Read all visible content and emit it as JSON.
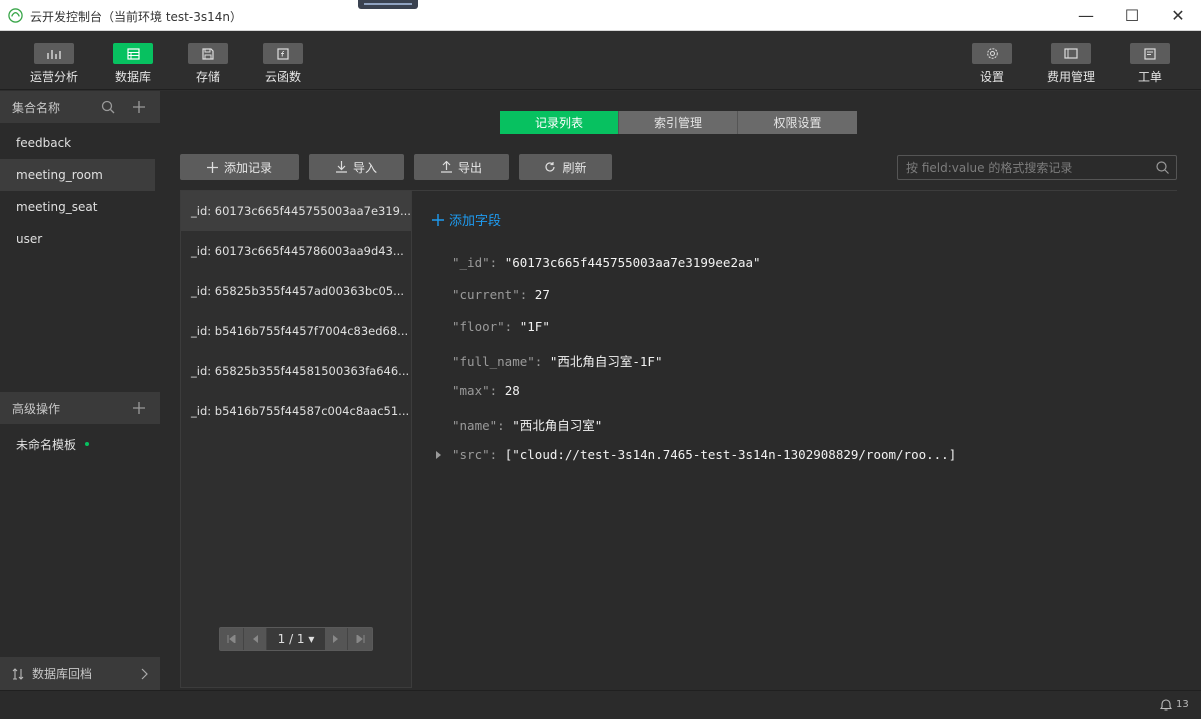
{
  "window": {
    "title": "云开发控制台（当前环境 test-3s14n）",
    "controls": {
      "minimize": "—",
      "maximize": "☐",
      "close": "✕"
    }
  },
  "toolbar": {
    "left": [
      {
        "label": "运营分析",
        "icon": "chart-icon"
      },
      {
        "label": "数据库",
        "icon": "database-icon",
        "active": true
      },
      {
        "label": "存储",
        "icon": "storage-icon"
      },
      {
        "label": "云函数",
        "icon": "function-icon"
      }
    ],
    "right": [
      {
        "label": "设置",
        "icon": "gear-icon"
      },
      {
        "label": "费用管理",
        "icon": "billing-icon"
      },
      {
        "label": "工单",
        "icon": "ticket-icon"
      }
    ]
  },
  "sidebar": {
    "collections_header": "集合名称",
    "collections": [
      "feedback",
      "meeting_room",
      "meeting_seat",
      "user"
    ],
    "selected_collection": "meeting_room",
    "advanced_header": "高级操作",
    "templates": [
      "未命名模板"
    ],
    "footer": "数据库回档"
  },
  "tabs": [
    "记录列表",
    "索引管理",
    "权限设置"
  ],
  "active_tab": "记录列表",
  "actions": {
    "add": "添加记录",
    "import": "导入",
    "export": "导出",
    "refresh": "刷新"
  },
  "search": {
    "placeholder": "按 field:value 的格式搜索记录"
  },
  "records": [
    "_id: 60173c665f445755003aa7e319...",
    "_id: 60173c665f445786003aa9d43...",
    "_id: 65825b355f4457ad00363bc05...",
    "_id: b5416b755f4457f7004c83ed68...",
    "_id: 65825b355f44581500363fa646...",
    "_id: b5416b755f44587c004c8aac51..."
  ],
  "pagination": {
    "label": "1 / 1 ▾"
  },
  "detail": {
    "add_field": "添加字段",
    "fields": [
      {
        "key": "\"_id\":",
        "value": "\"60173c665f445755003aa7e3199ee2aa\""
      },
      {
        "key": "\"current\":",
        "value": "27"
      },
      {
        "key": "\"floor\":",
        "value": "\"1F\""
      },
      {
        "key": "\"full_name\":",
        "value": "\"西北角自习室-1F\""
      },
      {
        "key": "\"max\":",
        "value": "28"
      },
      {
        "key": "\"name\":",
        "value": "\"西北角自习室\""
      },
      {
        "key": "\"src\":",
        "value": "[\"cloud://test-3s14n.7465-test-3s14n-1302908829/room/roo...]"
      }
    ]
  },
  "status": {
    "notifications": "13"
  },
  "colors": {
    "accent": "#07c160",
    "link": "#1e9bf0"
  }
}
